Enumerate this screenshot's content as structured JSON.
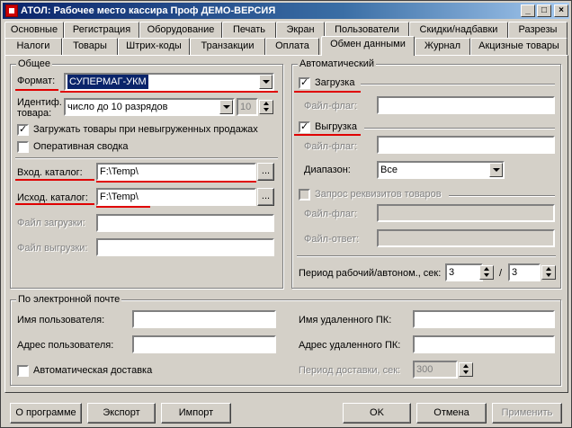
{
  "window": {
    "title": "АТОЛ: Рабочее место кассира Проф ДЕМО-ВЕРСИЯ"
  },
  "tabs_row1": [
    "Основные",
    "Регистрация",
    "Оборудование",
    "Печать",
    "Экран",
    "Пользователи",
    "Скидки/надбавки",
    "Разрезы"
  ],
  "tabs_row2": [
    "Налоги",
    "Товары",
    "Штрих-коды",
    "Транзакции",
    "Оплата",
    "Обмен данными",
    "Журнал",
    "Акцизные товары"
  ],
  "active_tab": "Обмен данными",
  "general": {
    "title": "Общее",
    "format_label": "Формат:",
    "format_value": "СУПЕРМАГ-УКМ",
    "ident_label": "Идентиф. товара:",
    "ident_value": "число до 10 разрядов",
    "ident_digits": "10",
    "load_unloaded_label": "Загружать товары при невыгруженных продажах",
    "load_unloaded_checked": true,
    "operative_label": "Оперативная сводка",
    "operative_checked": false,
    "in_dir_label": "Вход. каталог:",
    "in_dir_value": "F:\\Temp\\",
    "out_dir_label": "Исход. каталог:",
    "out_dir_value": "F:\\Temp\\",
    "browse_label": "...",
    "load_file_label": "Файл загрузки:",
    "unload_file_label": "Файл выгрузки:"
  },
  "auto": {
    "title": "Автоматический",
    "load_label": "Загрузка",
    "load_checked": true,
    "flag_label": "Файл-флаг:",
    "unload_label": "Выгрузка",
    "unload_checked": true,
    "range_label": "Диапазон:",
    "range_value": "Все",
    "request_label": "Запрос реквизитов товаров",
    "answer_label": "Файл-ответ:",
    "period_label": "Период рабочий/автоном., сек:",
    "period_work": "3",
    "period_slash": "/",
    "period_auto": "3"
  },
  "email": {
    "title": "По электронной почте",
    "user_label": "Имя пользователя:",
    "address_label": "Адрес пользователя:",
    "remote_name_label": "Имя удаленного ПК:",
    "remote_address_label": "Адрес удаленного ПК:",
    "auto_delivery_label": "Автоматическая доставка",
    "auto_delivery_checked": false,
    "period_label": "Период доставки, сек:",
    "period_value": "300"
  },
  "buttons": {
    "about": "О программе",
    "export": "Экспорт",
    "import": "Импорт",
    "ok": "OK",
    "cancel": "Отмена",
    "apply": "Применить"
  },
  "titlebar_buttons": {
    "minimize": "_",
    "maximize": "□",
    "close": "×"
  },
  "check_mark": "✓",
  "colors": {
    "title_start": "#0a246a",
    "title_end": "#a6caf0",
    "face": "#d4d0c8",
    "highlight_line": "#e00000"
  }
}
